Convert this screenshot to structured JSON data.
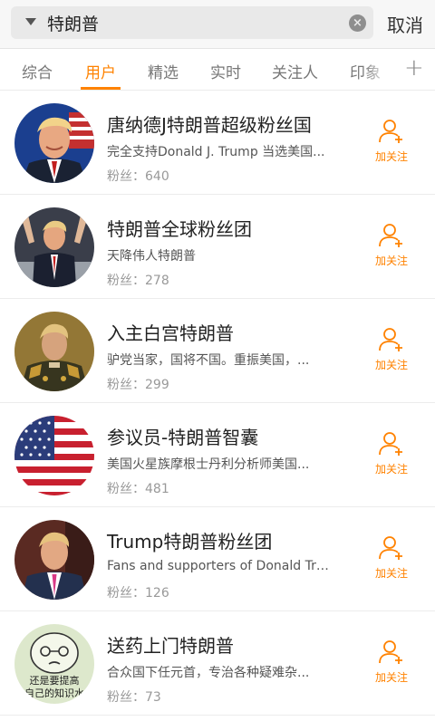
{
  "search": {
    "query": "特朗普",
    "cancel_label": "取消"
  },
  "tabs": [
    {
      "label": "综合"
    },
    {
      "label": "用户"
    },
    {
      "label": "精选"
    },
    {
      "label": "实时"
    },
    {
      "label": "关注人"
    },
    {
      "label": "印象"
    }
  ],
  "active_tab": "用户",
  "follow_label": "加关注",
  "users": [
    {
      "name": "唐纳德J特朗普超级粉丝国",
      "desc": "完全支持Donald J. Trump 当选美国...",
      "fans": "粉丝：640"
    },
    {
      "name": "特朗普全球粉丝团",
      "desc": "天降伟人特朗普",
      "fans": "粉丝：278"
    },
    {
      "name": "入主白宫特朗普",
      "desc": "驴党当家，国将不国。重振美国，...",
      "fans": "粉丝：299"
    },
    {
      "name": "参议员-特朗普智囊",
      "desc": "美国火星族摩根士丹利分析师美国...",
      "fans": "粉丝：481"
    },
    {
      "name": "Trump特朗普粉丝团",
      "desc": "Fans and supporters of Donald Trump.",
      "fans": "粉丝：126"
    },
    {
      "name": "送药上门特朗普",
      "desc": "合众国下任元首，专治各种疑难杂...",
      "fans": "粉丝：73",
      "avatar_text": [
        "还是要提高",
        "自己的知识水"
      ]
    }
  ],
  "colors": {
    "accent": "#ff8200"
  },
  "icons": {
    "clear": "clear-icon",
    "follow": "add-user-icon",
    "dropdown": "dropdown-arrow-icon",
    "add_tab": "plus-icon"
  }
}
